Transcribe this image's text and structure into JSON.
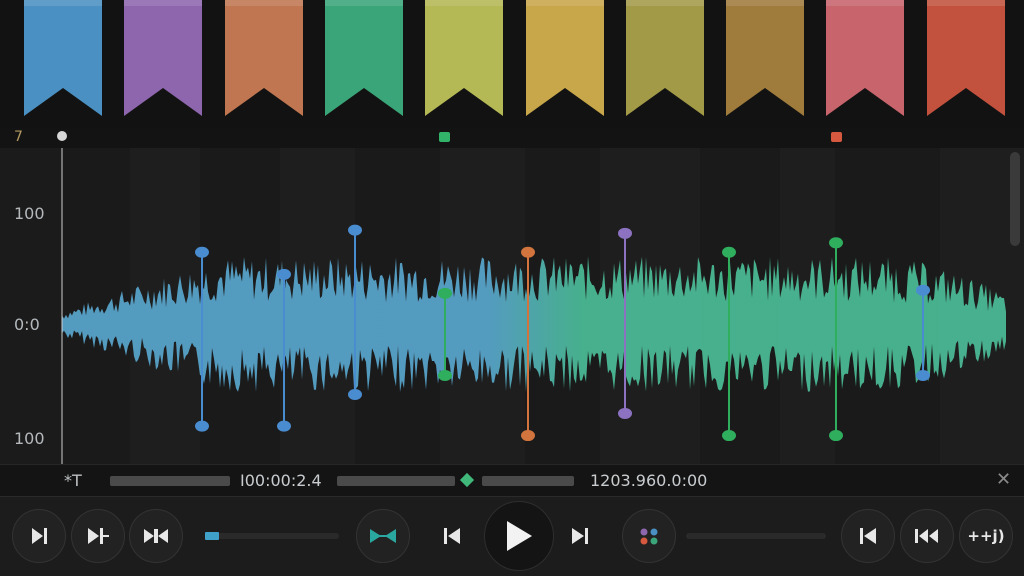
{
  "markers": [
    {
      "color": "#4a90c2"
    },
    {
      "color": "#8e66ad"
    },
    {
      "color": "#c07650"
    },
    {
      "color": "#3aa579"
    },
    {
      "color": "#b4b855"
    },
    {
      "color": "#c8a64a"
    },
    {
      "color": "#a39a48"
    },
    {
      "color": "#a07c3c"
    },
    {
      "color": "#c8646c"
    },
    {
      "color": "#c2523e"
    }
  ],
  "ruler": {
    "label": "7",
    "handles": [
      {
        "name": "ruler-handle-green",
        "color": "#31b36a"
      },
      {
        "name": "ruler-handle-red",
        "color": "#d6593f"
      }
    ]
  },
  "waveform": {
    "y_ticks": [
      "100",
      "0:0",
      "100"
    ],
    "color_left": "#5aa9d2",
    "color_right": "#4cc09a",
    "cue_points": [
      {
        "color": "#4a8cd0",
        "top": 0.33,
        "bottom": 0.88
      },
      {
        "color": "#4a8cd0",
        "top": 0.4,
        "bottom": 0.88
      },
      {
        "color": "#4a8cd0",
        "top": 0.26,
        "bottom": 0.78
      },
      {
        "color": "#2fae5e",
        "top": 0.46,
        "bottom": 0.72
      },
      {
        "color": "#d2743e",
        "top": 0.33,
        "bottom": 0.91
      },
      {
        "color": "#8d72c2",
        "top": 0.27,
        "bottom": 0.84
      },
      {
        "color": "#2fae5e",
        "top": 0.33,
        "bottom": 0.91
      },
      {
        "color": "#2fae5e",
        "top": 0.3,
        "bottom": 0.91
      },
      {
        "color": "#4a8cd0",
        "top": 0.45,
        "bottom": 0.72
      }
    ]
  },
  "info": {
    "prefix": "*T",
    "time_a": "I00:00:2.4",
    "time_b": "1203.960.0:00",
    "close": "✕"
  },
  "transport": {
    "buttons": [
      {
        "name": "skip-to-start-button",
        "icon": "skip-start-icon"
      },
      {
        "name": "step-forward-button",
        "icon": "step-forward-icon"
      },
      {
        "name": "join-markers-button",
        "icon": "bowtie-icon"
      },
      {
        "name": "loop-toggle-button",
        "icon": "bowtie-teal-icon"
      },
      {
        "name": "previous-button",
        "icon": "previous-icon"
      },
      {
        "name": "play-button",
        "icon": "play-icon"
      },
      {
        "name": "next-button",
        "icon": "next-icon"
      },
      {
        "name": "color-menu-button",
        "icon": "color-dots-icon"
      },
      {
        "name": "go-start-button",
        "icon": "go-start-icon"
      },
      {
        "name": "rewind-button",
        "icon": "rewind-icon"
      },
      {
        "name": "sync-button",
        "icon": "sync-icon"
      }
    ],
    "sync_label": "++j)"
  }
}
